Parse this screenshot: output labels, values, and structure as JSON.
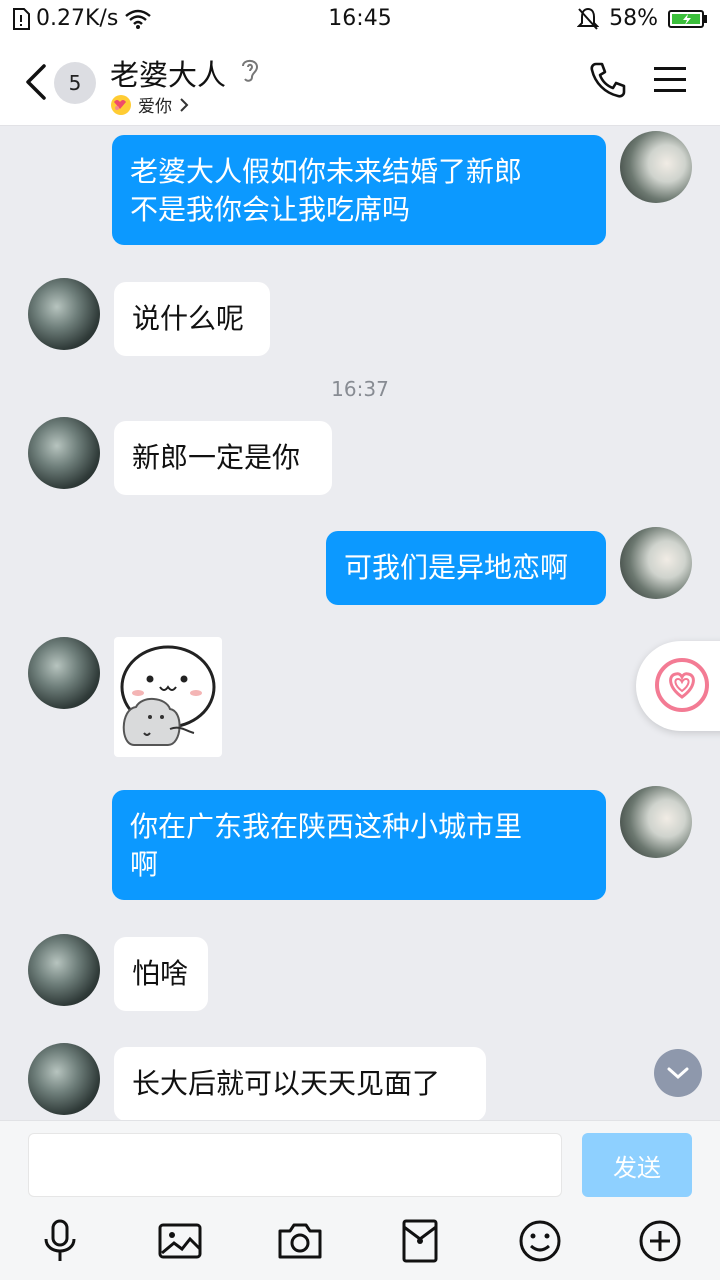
{
  "status": {
    "speed": "0.27K/s",
    "time": "16:45",
    "battery": "58%"
  },
  "header": {
    "badge": "5",
    "title": "老婆大人",
    "subtitle": "爱你"
  },
  "messages": {
    "m1": {
      "text_line1": "老婆大人假如你未来结婚了新郎",
      "text_line2": "不是我你会让我吃席吗"
    },
    "m2": {
      "text": "说什么呢"
    },
    "time1": "16:37",
    "m3": {
      "text": "新郎一定是你"
    },
    "m4": {
      "text": "可我们是异地恋啊"
    },
    "m6": {
      "text_line1": "你在广东我在陕西这种小城市里",
      "text_line2": "啊"
    },
    "m7": {
      "text": "怕啥"
    },
    "m8": {
      "text": "长大后就可以天天见面了"
    }
  },
  "input": {
    "value": "",
    "send_label": "发送"
  },
  "icons": {
    "status": [
      "sim-icon",
      "wifi-icon",
      "mute-icon",
      "battery-icon"
    ],
    "header": [
      "back-icon",
      "ear-icon",
      "phone-icon",
      "menu-icon"
    ],
    "toolbar": [
      "mic-icon",
      "image-icon",
      "camera-icon",
      "hongbao-icon",
      "emoji-icon",
      "plus-icon"
    ]
  },
  "colors": {
    "accent": "#0c99ff",
    "background": "#ebecf0",
    "send_disabled": "#8ed0ff"
  }
}
